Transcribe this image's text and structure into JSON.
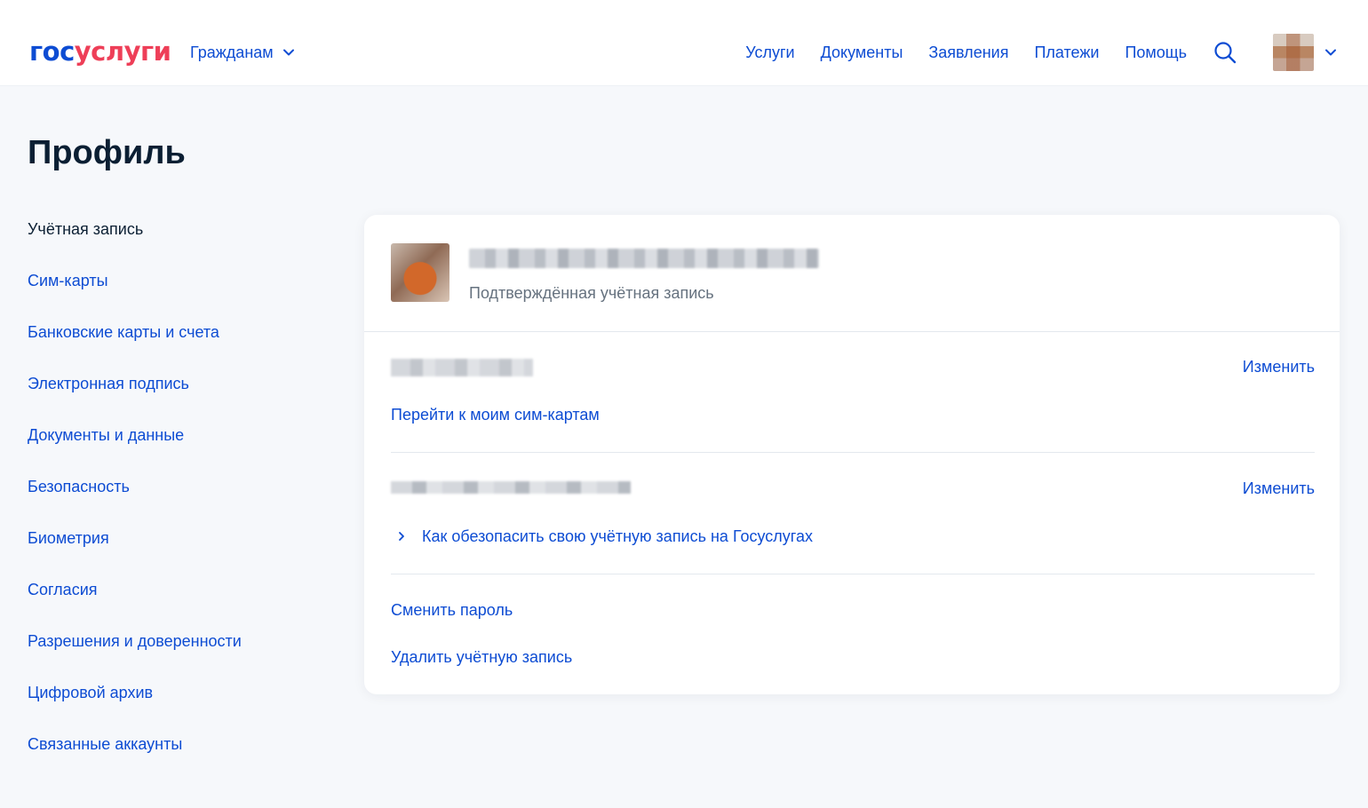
{
  "header": {
    "logo_part1": "гос",
    "logo_part2": "услуги",
    "audience": "Гражданам",
    "nav": [
      "Услуги",
      "Документы",
      "Заявления",
      "Платежи",
      "Помощь"
    ],
    "brand_blue": "#0d4cd3",
    "brand_red": "#ee3f58"
  },
  "page": {
    "title": "Профиль"
  },
  "sidebar": {
    "items": [
      "Учётная запись",
      "Сим-карты",
      "Банковские карты и счета",
      "Электронная подпись",
      "Документы и данные",
      "Безопасность",
      "Биометрия",
      "Согласия",
      "Разрешения и доверенности",
      "Цифровой архив",
      "Связанные аккаунты"
    ]
  },
  "account": {
    "status": "Подтверждённая учётная запись",
    "change_label": "Изменить",
    "sim_link": "Перейти к моим сим-картам",
    "secure_link": "Как обезопасить свою учётную запись на Госуслугах",
    "change_password": "Сменить пароль",
    "delete_account": "Удалить учётную запись"
  }
}
